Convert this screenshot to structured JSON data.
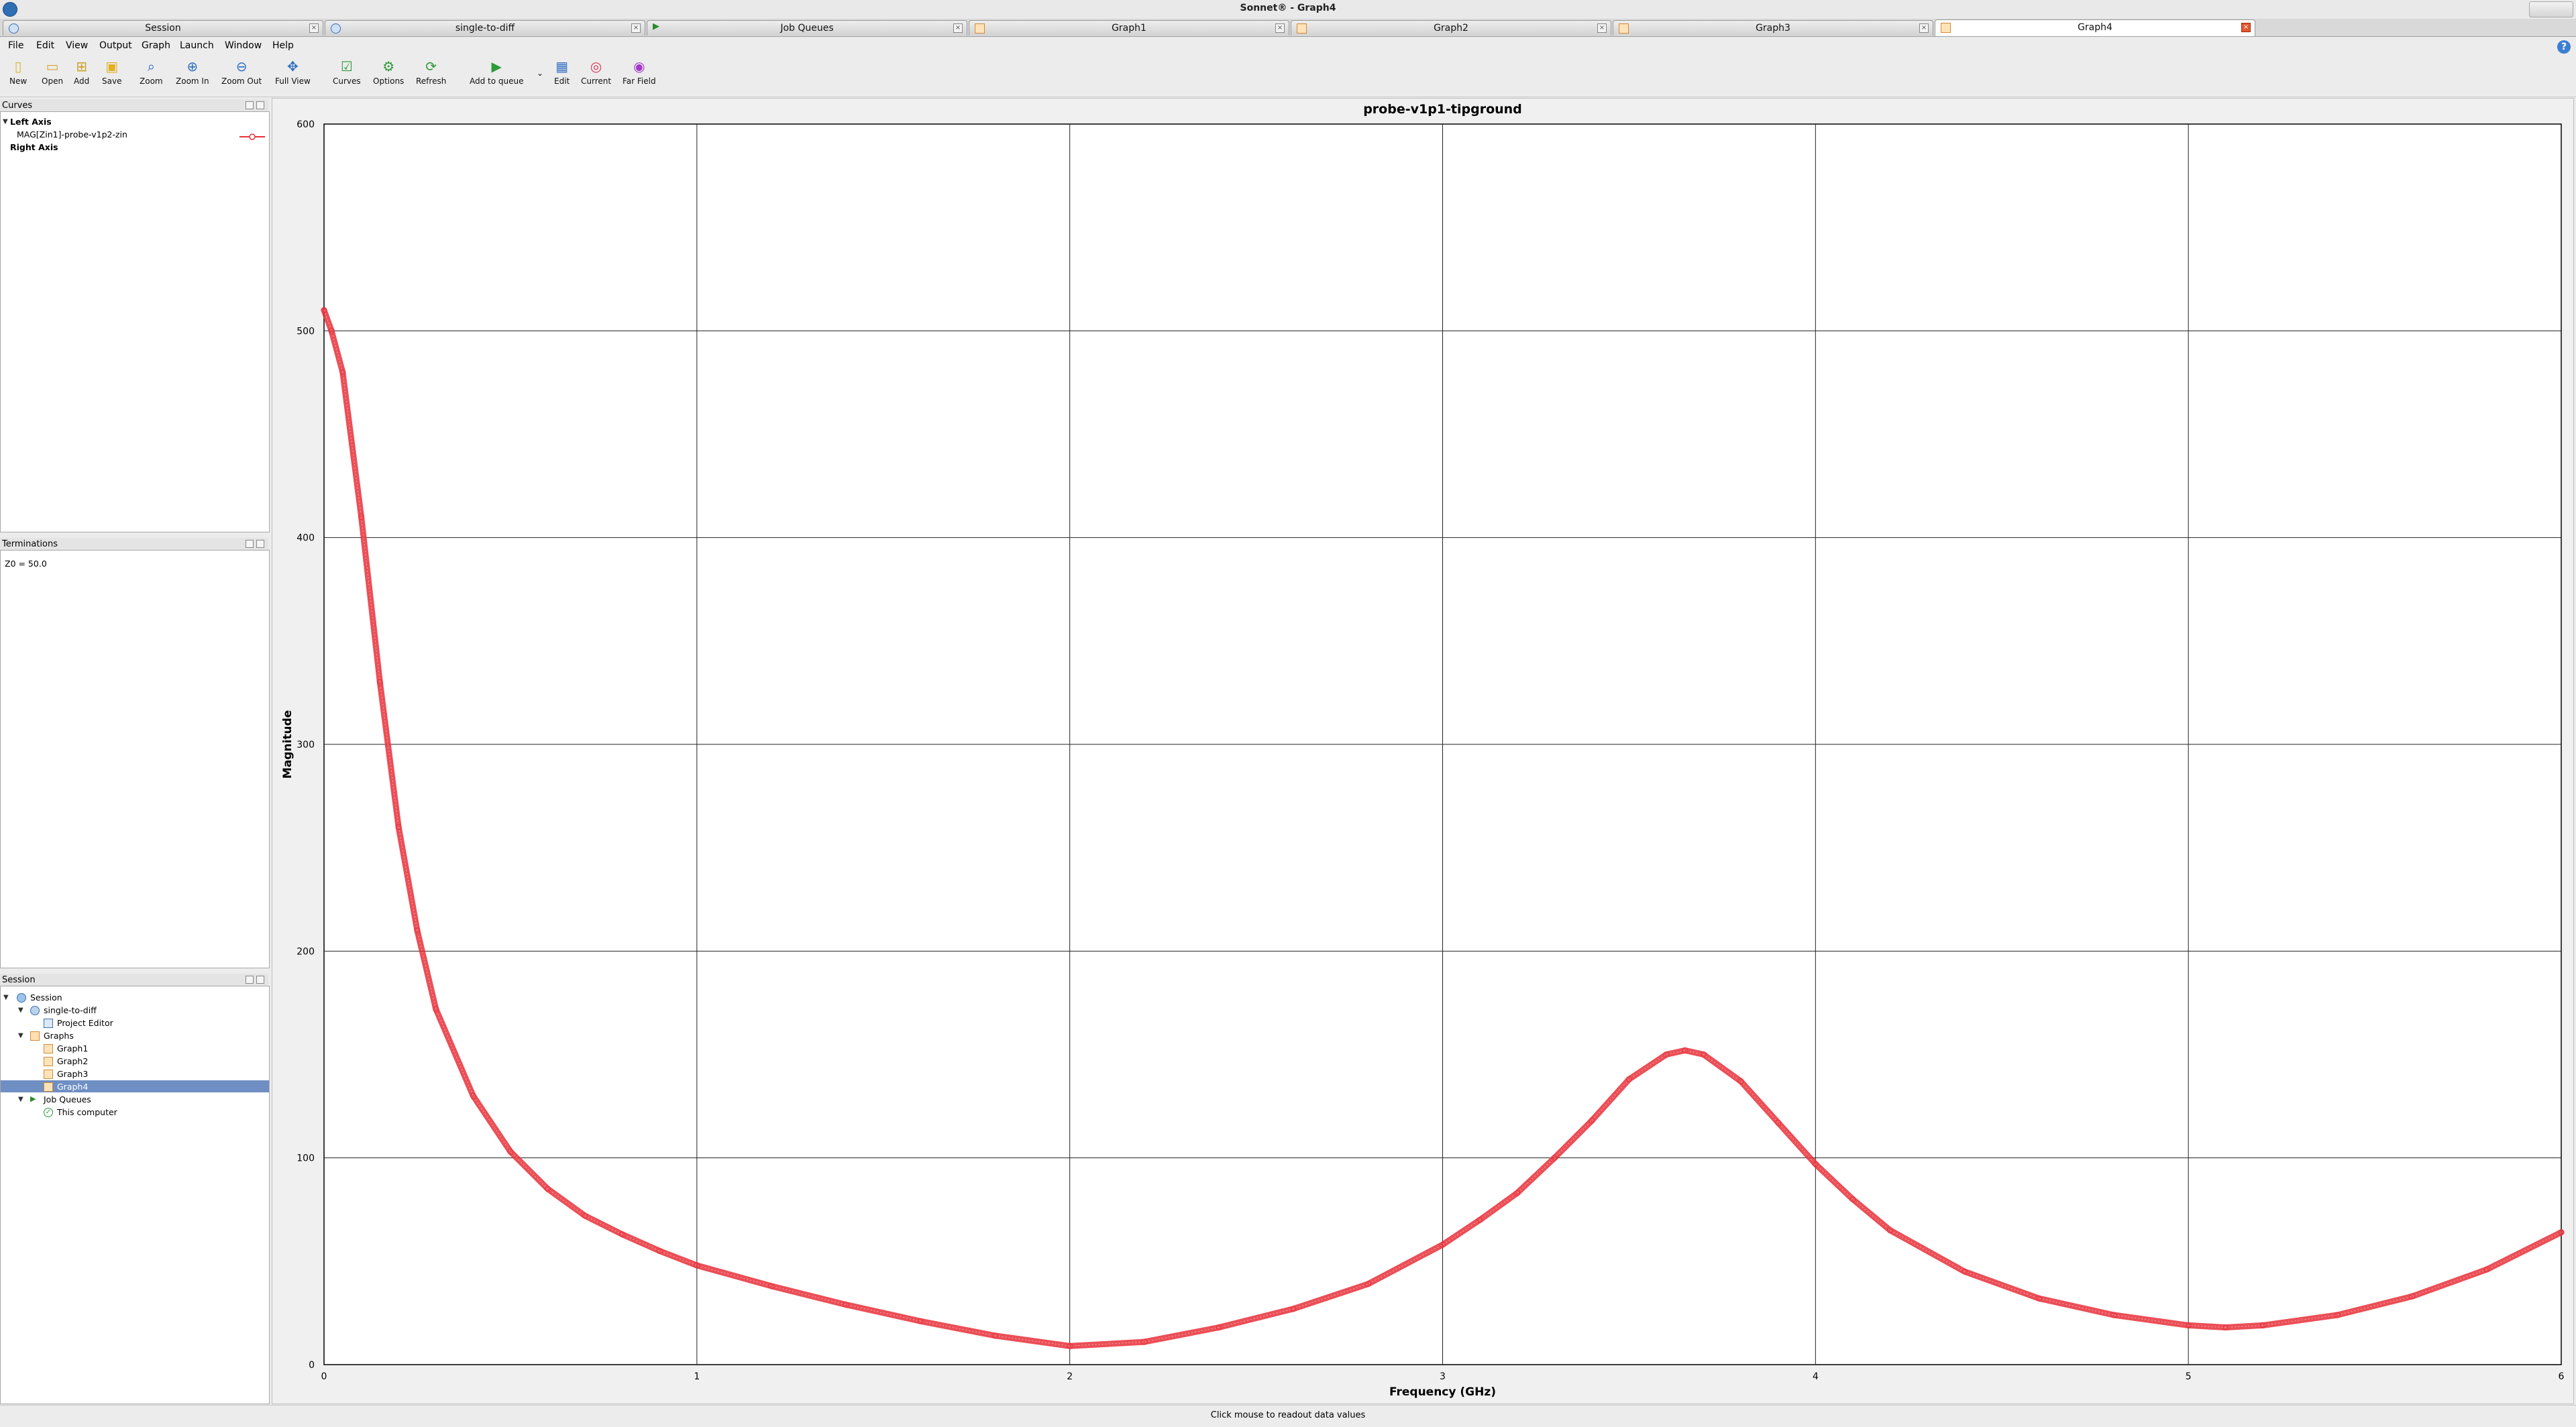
{
  "window": {
    "title": "Sonnet® - Graph4"
  },
  "tabs": [
    {
      "label": "Session",
      "icon": "globe-icon"
    },
    {
      "label": "single-to-diff",
      "icon": "project-icon"
    },
    {
      "label": "Job Queues",
      "icon": "queue-icon"
    },
    {
      "label": "Graph1",
      "icon": "graph-icon"
    },
    {
      "label": "Graph2",
      "icon": "graph-icon"
    },
    {
      "label": "Graph3",
      "icon": "graph-icon"
    },
    {
      "label": "Graph4",
      "icon": "graph-icon",
      "active": true
    }
  ],
  "menu": [
    "File",
    "Edit",
    "View",
    "Output",
    "Graph",
    "Launch",
    "Window",
    "Help"
  ],
  "toolbar": [
    {
      "label": "New",
      "icon": "new-file-icon"
    },
    {
      "label": "Open",
      "icon": "open-folder-icon"
    },
    {
      "label": "Add",
      "icon": "add-icon"
    },
    {
      "label": "Save",
      "icon": "save-icon"
    },
    {
      "label": "Zoom",
      "icon": "zoom-icon"
    },
    {
      "label": "Zoom In",
      "icon": "zoom-in-icon"
    },
    {
      "label": "Zoom Out",
      "icon": "zoom-out-icon"
    },
    {
      "label": "Full View",
      "icon": "full-view-icon"
    },
    {
      "label": "Curves",
      "icon": "curves-icon"
    },
    {
      "label": "Options",
      "icon": "options-icon"
    },
    {
      "label": "Refresh",
      "icon": "refresh-icon"
    },
    {
      "label": "Add to queue",
      "icon": "add-to-queue-icon"
    },
    {
      "label": "Edit",
      "icon": "edit-icon"
    },
    {
      "label": "Current",
      "icon": "current-icon"
    },
    {
      "label": "Far Field",
      "icon": "far-field-icon"
    }
  ],
  "curves_panel": {
    "title": "Curves",
    "left_axis": "Left Axis",
    "curve": "MAG[Zin1]-probe-v1p2-zin",
    "right_axis": "Right Axis",
    "curve_color": "#e8303a"
  },
  "terminations_panel": {
    "title": "Terminations",
    "text": "Z0 = 50.0"
  },
  "session_panel": {
    "title": "Session",
    "items": [
      "Session",
      "single-to-diff",
      "Project Editor",
      "Graphs",
      "Graph1",
      "Graph2",
      "Graph3",
      "Graph4",
      "Job Queues",
      "This computer"
    ],
    "selected": "Graph4"
  },
  "status": "Click mouse to readout data values",
  "chart_data": {
    "type": "line",
    "title": "probe-v1p1-tipground",
    "xlabel": "Frequency (GHz)",
    "ylabel": "Magnitude",
    "xlim": [
      0,
      6
    ],
    "ylim": [
      0,
      600
    ],
    "xticks": [
      "0",
      "1",
      "2",
      "3",
      "4",
      "5",
      "6"
    ],
    "yticks": [
      "0",
      "100",
      "200",
      "300",
      "400",
      "500",
      "600"
    ],
    "grid": true,
    "series": [
      {
        "color": "#e8303a",
        "x": [
          0,
          0.02,
          0.05,
          0.1,
          0.15,
          0.2,
          0.25,
          0.3,
          0.4,
          0.5,
          0.6,
          0.7,
          0.8,
          0.9,
          1.0,
          1.2,
          1.4,
          1.6,
          1.8,
          2.0,
          2.2,
          2.4,
          2.6,
          2.8,
          3.0,
          3.1,
          3.2,
          3.3,
          3.4,
          3.5,
          3.6,
          3.65,
          3.7,
          3.8,
          3.9,
          4.0,
          4.1,
          4.2,
          4.4,
          4.6,
          4.8,
          5.0,
          5.1,
          5.2,
          5.4,
          5.6,
          5.8,
          6.0
        ],
        "values": [
          510,
          500,
          480,
          410,
          330,
          260,
          210,
          172,
          130,
          103,
          85,
          72,
          63,
          55,
          48,
          38,
          29,
          21,
          14,
          9,
          11,
          18,
          27,
          39,
          58,
          70,
          83,
          100,
          118,
          138,
          150,
          152,
          150,
          137,
          117,
          97,
          80,
          65,
          45,
          32,
          24,
          19,
          18,
          19,
          24,
          33,
          46,
          64
        ]
      }
    ]
  }
}
